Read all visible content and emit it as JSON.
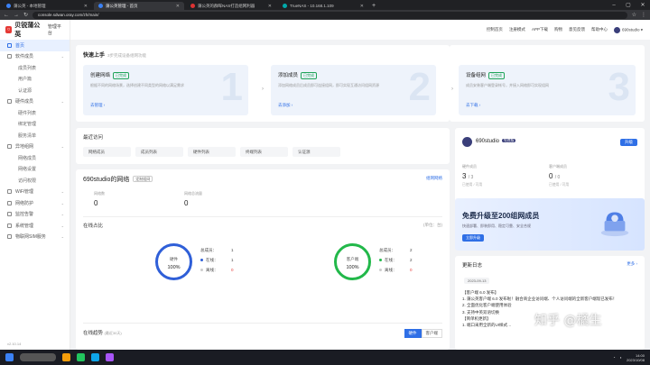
{
  "browser": {
    "tabs": [
      {
        "label": "蒲公英 - 本地管理",
        "active": false
      },
      {
        "label": "蒲公英管理 - 首页",
        "active": true
      },
      {
        "label": "蒲公英的群晖NAS打造组网利器",
        "active": false
      },
      {
        "label": "TrueNAS - 10.168.1.109",
        "active": false
      }
    ],
    "url": "console.sdwan.oray.com/zh/main/"
  },
  "sidebar": {
    "brand": "贝锐蒲公英",
    "platform": "管理平台",
    "items": [
      {
        "label": "首页",
        "level": 0,
        "active": true,
        "expand": false
      },
      {
        "label": "软件成员",
        "level": 0,
        "active": false,
        "expand": true
      },
      {
        "label": "成员列表",
        "level": 1,
        "active": false,
        "expand": false
      },
      {
        "label": "用户篇",
        "level": 1,
        "active": false,
        "expand": false
      },
      {
        "label": "认证源",
        "level": 1,
        "active": false,
        "expand": false
      },
      {
        "label": "硬件成员",
        "level": 0,
        "active": false,
        "expand": true
      },
      {
        "label": "硬件列表",
        "level": 1,
        "active": false,
        "expand": false
      },
      {
        "label": "绑定管理",
        "level": 1,
        "active": false,
        "expand": false
      },
      {
        "label": "服务清单",
        "level": 1,
        "active": false,
        "expand": false
      },
      {
        "label": "异地组网",
        "level": 0,
        "active": false,
        "expand": true
      },
      {
        "label": "网络成员",
        "level": 1,
        "active": false,
        "expand": false
      },
      {
        "label": "网络设置",
        "level": 1,
        "active": false,
        "expand": false
      },
      {
        "label": "访问权限",
        "level": 1,
        "active": false,
        "expand": false
      },
      {
        "label": "WiFi管理",
        "level": 0,
        "active": false,
        "expand": true
      },
      {
        "label": "网络防护",
        "level": 0,
        "active": false,
        "expand": true
      },
      {
        "label": "监控告警",
        "level": 0,
        "active": false,
        "expand": true
      },
      {
        "label": "系统管理",
        "level": 0,
        "active": false,
        "expand": true
      },
      {
        "label": "物联网SIM服务",
        "level": 0,
        "active": false,
        "expand": true
      }
    ],
    "version": "v2.10.14"
  },
  "topbar": {
    "links": [
      "控制首页",
      "注册模式",
      "APP下载",
      "购物",
      "意见反馈",
      "帮助中心"
    ],
    "username": "690studio"
  },
  "quickstart": {
    "title": "快速上手",
    "subtitle": "3步完成设备组网功能",
    "steps": [
      {
        "num": "1",
        "title": "创建网络",
        "badge": "已完成",
        "desc": "根据不同的网络场景，选择创建不同类型的网络以满足需求",
        "link": "去管理 ›"
      },
      {
        "num": "2",
        "title": "添加成员",
        "badge": "已完成",
        "desc": "添加网络成员后成员即可连接组网，即可实现互通访问组网资源",
        "link": "去添加 ›"
      },
      {
        "num": "3",
        "title": "设备组网",
        "badge": "已完成",
        "desc": "成员安装客户端登录帐号，并接入网络即可实现组网",
        "link": "去下载 ›"
      }
    ]
  },
  "recent": {
    "title": "最近访问",
    "items": [
      "网络成员",
      "成员列表",
      "硬件列表",
      "终端列表",
      "认证源"
    ]
  },
  "network": {
    "title": "690studio的网络",
    "badge": "定制组网",
    "link": "组网网络",
    "stats": [
      {
        "label": "网络数",
        "value": "0"
      },
      {
        "label": "网络总流量",
        "value": "0"
      }
    ],
    "online_title": "在线占比",
    "online_unit": "(单位：台)",
    "hardware": {
      "label": "硬件",
      "percent": "100%",
      "total_label": "总成员：",
      "total": "1",
      "online_label": "在线：",
      "online": "1",
      "offline_label": "离线：",
      "offline": "0",
      "color": "#2f5fd8"
    },
    "client": {
      "label": "客户端",
      "percent": "100%",
      "total_label": "总成员：",
      "total": "2",
      "online_label": "在线：",
      "online": "2",
      "offline_label": "离线：",
      "offline": "0",
      "color": "#22b84a"
    },
    "trend_title": "在线趋势",
    "trend_sub": "(最近30天)",
    "trend_tabs": [
      "硬件",
      "客户端"
    ]
  },
  "profile": {
    "name": "690studio",
    "tag": "免费版",
    "button": "升级",
    "stats": [
      {
        "label": "硬件成员",
        "value": "3",
        "max": "/ 3",
        "sub": "已使用 / 可用"
      },
      {
        "label": "客户端成员",
        "value": "0",
        "max": "/ 0",
        "sub": "已使用 / 可用"
      }
    ]
  },
  "upgrade": {
    "title": "免费升级至200组网成员",
    "desc": "快速部署、即装即用、稳定可靠、安全合规",
    "button": "立即升级"
  },
  "changelog": {
    "title": "更新日志",
    "more": "更多 ›",
    "date": "2023-09-13",
    "lines": [
      "【客户端 6.0 发布】",
      "1. 蒲公英客户端 6.0 发布啦！融合商企业访问端、个人访问端的全新客户端现已发布！",
      "2. 全面优化客户端使用体验",
      "3. 支持中英双语切换",
      "【简单机更新】",
      "1. 端口采用全新的UI样式…"
    ]
  },
  "taskbar": {
    "time": "14:00",
    "date": "2023/10/08"
  },
  "watermark": "知乎 @橘生"
}
